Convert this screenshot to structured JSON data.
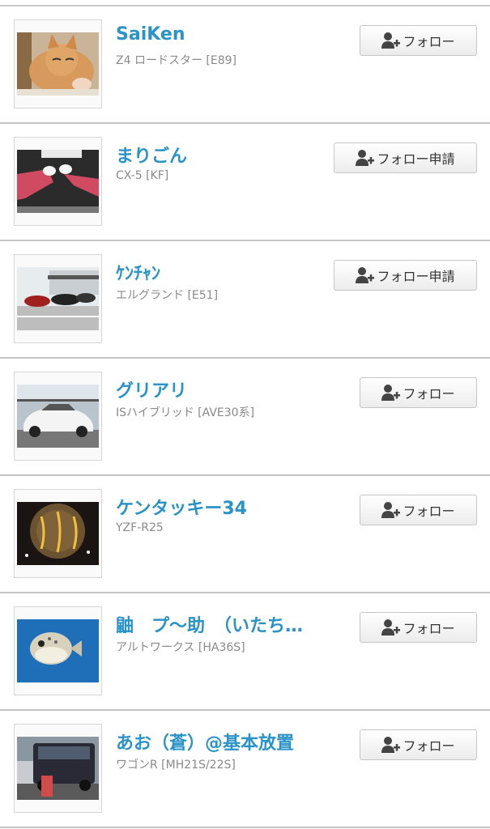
{
  "users": [
    {
      "name": "SaiKen",
      "car": "Z4 ロードスター [E89]",
      "button": "フォロー",
      "button_icon": "add-user-icon",
      "photo": "cat-icon"
    },
    {
      "name": "まりごん",
      "car": "CX-5 [KF]",
      "button": "フォロー申請",
      "button_icon": "add-user-icon",
      "photo": "legs-icon"
    },
    {
      "name": "ｹﾝﾁｬﾝ",
      "car": "エルグランド [E51]",
      "button": "フォロー申請",
      "button_icon": "add-user-icon",
      "photo": "parking-lot-icon"
    },
    {
      "name": "グリアリ",
      "car": "ISハイブリッド [AVE30系]",
      "button": "フォロー",
      "button_icon": "add-user-icon",
      "photo": "white-car-icon"
    },
    {
      "name": "ケンタッキー34",
      "car": "YZF-R25",
      "button": "フォロー",
      "button_icon": "add-user-icon",
      "photo": "calligraphy-icon"
    },
    {
      "name": "鼬　プ〜助　（いたち…",
      "car": "アルトワークス [HA36S]",
      "button": "フォロー",
      "button_icon": "add-user-icon",
      "photo": "pufferfish-icon"
    },
    {
      "name": "あお（蒼）@基本放置",
      "car": "ワゴンR [MH21S/22S]",
      "button": "フォロー",
      "button_icon": "add-user-icon",
      "photo": "van-icon"
    }
  ],
  "colors": {
    "name": "#2a93c7",
    "car": "#8a8a8a",
    "divider": "#c4c4c4"
  }
}
